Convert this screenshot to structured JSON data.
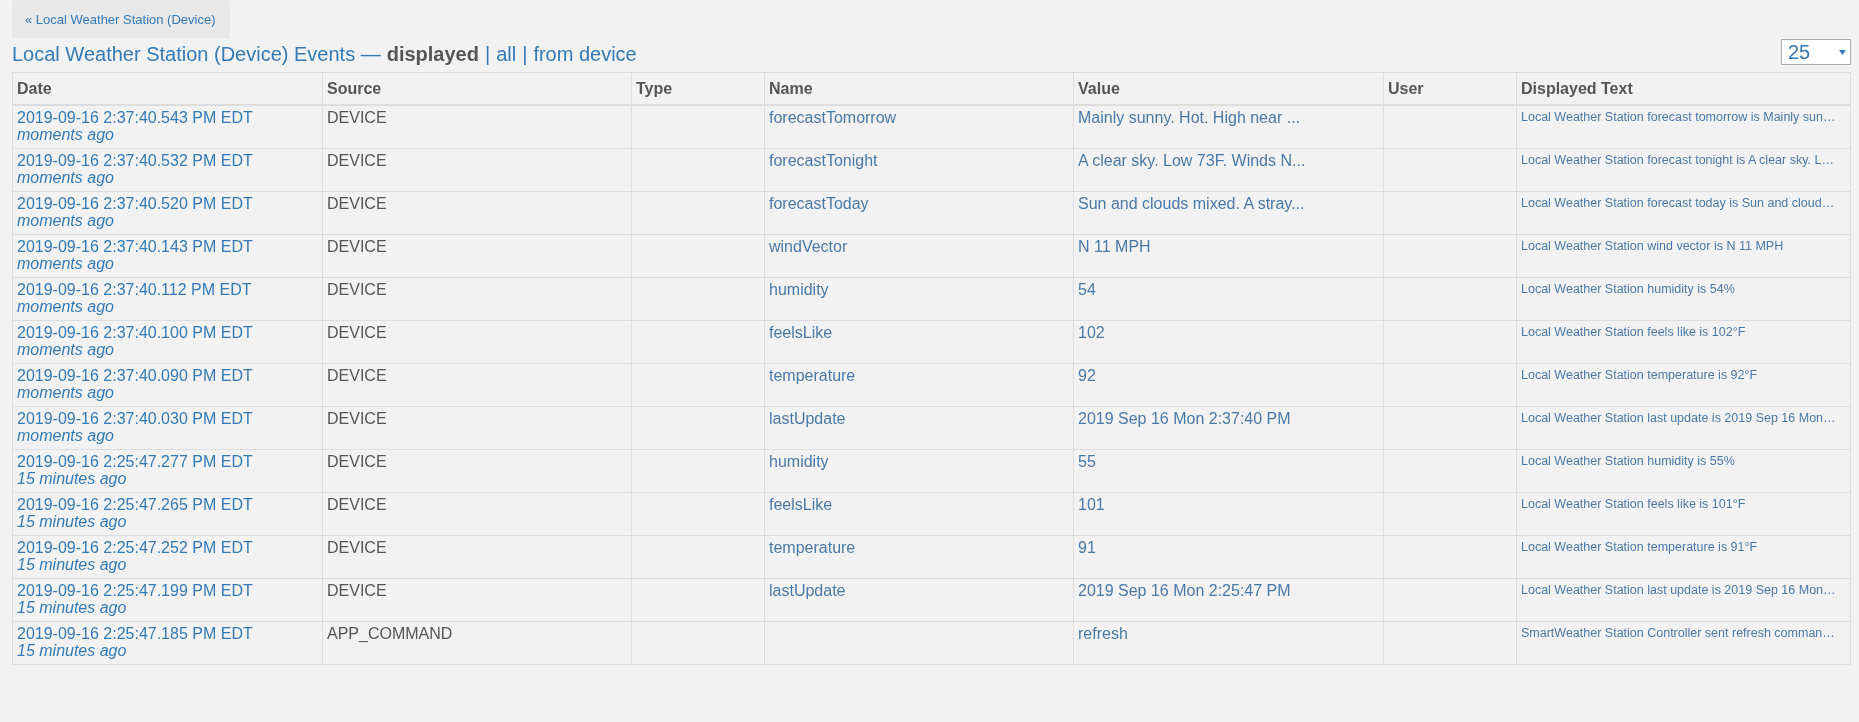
{
  "back_link": "« Local Weather Station (Device)",
  "heading": {
    "title": "Local Weather Station (Device) Events —",
    "separator": "|",
    "views": [
      {
        "label": "displayed",
        "selected": true
      },
      {
        "label": "all",
        "selected": false
      },
      {
        "label": "from device",
        "selected": false
      }
    ]
  },
  "page_size": {
    "value": "25"
  },
  "table": {
    "columns": [
      "Date",
      "Source",
      "Type",
      "Name",
      "Value",
      "User",
      "Displayed Text"
    ],
    "rows": [
      {
        "date": "2019-09-16 2:37:40.543 PM EDT",
        "ago": "moments ago",
        "source": "DEVICE",
        "name": "forecastTomorrow",
        "value": "Mainly sunny. Hot. High near ...",
        "text": "Local Weather Station forecast tomorrow is Mainly sun…"
      },
      {
        "date": "2019-09-16 2:37:40.532 PM EDT",
        "ago": "moments ago",
        "source": "DEVICE",
        "name": "forecastTonight",
        "value": "A clear sky. Low 73F. Winds N...",
        "text": "Local Weather Station forecast tonight is A clear sky. L…"
      },
      {
        "date": "2019-09-16 2:37:40.520 PM EDT",
        "ago": "moments ago",
        "source": "DEVICE",
        "name": "forecastToday",
        "value": "Sun and clouds mixed. A stray...",
        "text": "Local Weather Station forecast today is Sun and cloud…"
      },
      {
        "date": "2019-09-16 2:37:40.143 PM EDT",
        "ago": "moments ago",
        "source": "DEVICE",
        "name": "windVector",
        "value": "N 11 MPH",
        "text": "Local Weather Station wind vector is N 11 MPH"
      },
      {
        "date": "2019-09-16 2:37:40.112 PM EDT",
        "ago": "moments ago",
        "source": "DEVICE",
        "name": "humidity",
        "value": "54",
        "text": "Local Weather Station humidity is 54%"
      },
      {
        "date": "2019-09-16 2:37:40.100 PM EDT",
        "ago": "moments ago",
        "source": "DEVICE",
        "name": "feelsLike",
        "value": "102",
        "text": "Local Weather Station feels like is 102°F"
      },
      {
        "date": "2019-09-16 2:37:40.090 PM EDT",
        "ago": "moments ago",
        "source": "DEVICE",
        "name": "temperature",
        "value": "92",
        "text": "Local Weather Station temperature is 92°F"
      },
      {
        "date": "2019-09-16 2:37:40.030 PM EDT",
        "ago": "moments ago",
        "source": "DEVICE",
        "name": "lastUpdate",
        "value": "2019 Sep 16 Mon 2:37:40 PM",
        "text": "Local Weather Station last update is 2019 Sep 16 Mon…"
      },
      {
        "date": "2019-09-16 2:25:47.277 PM EDT",
        "ago": "15 minutes ago",
        "source": "DEVICE",
        "name": "humidity",
        "value": "55",
        "text": "Local Weather Station humidity is 55%"
      },
      {
        "date": "2019-09-16 2:25:47.265 PM EDT",
        "ago": "15 minutes ago",
        "source": "DEVICE",
        "name": "feelsLike",
        "value": "101",
        "text": "Local Weather Station feels like is 101°F"
      },
      {
        "date": "2019-09-16 2:25:47.252 PM EDT",
        "ago": "15 minutes ago",
        "source": "DEVICE",
        "name": "temperature",
        "value": "91",
        "text": "Local Weather Station temperature is 91°F"
      },
      {
        "date": "2019-09-16 2:25:47.199 PM EDT",
        "ago": "15 minutes ago",
        "source": "DEVICE",
        "name": "lastUpdate",
        "value": "2019 Sep 16 Mon 2:25:47 PM",
        "text": "Local Weather Station last update is 2019 Sep 16 Mon…"
      },
      {
        "date": "2019-09-16 2:25:47.185 PM EDT",
        "ago": "15 minutes ago",
        "source": "APP_COMMAND",
        "value": "refresh",
        "text": "SmartWeather Station Controller sent refresh comman…"
      }
    ]
  }
}
